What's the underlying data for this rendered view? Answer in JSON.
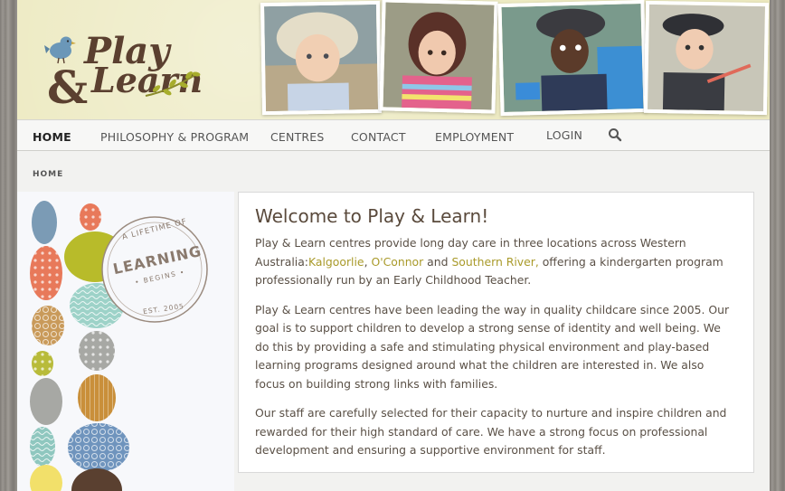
{
  "brand": {
    "logo_line1": "Play",
    "logo_amp": "&",
    "logo_line2": "Learn"
  },
  "nav": {
    "items": [
      {
        "label": "HOME",
        "active": true
      },
      {
        "label": "PHILOSOPHY & PROGRAM",
        "active": false
      },
      {
        "label": "CENTRES",
        "active": false
      },
      {
        "label": "CONTACT",
        "active": false
      },
      {
        "label": "EMPLOYMENT",
        "active": false
      },
      {
        "label": "LOGIN",
        "active": false
      }
    ],
    "search_icon": "search-icon"
  },
  "breadcrumb": "HOME",
  "badge": {
    "top": "A LIFETIME OF",
    "center": "LEARNING",
    "sub": "• BEGINS •",
    "bottom": "EST. 2005"
  },
  "main": {
    "heading": "Welcome to Play & Learn!",
    "p1_before": "Play & Learn centres provide long day care in three locations across Western Australia:",
    "link1": "Kalgoorlie",
    "sep1": ", ",
    "link2": "O'Connor",
    "sep2": " and ",
    "link3": "Southern River,",
    "p1_after": " offering a kindergarten program professionally run by an Early Childhood Teacher.",
    "p2": "Play & Learn centres have been leading the way in quality childcare since 2005. Our goal is to support children to develop a strong sense of identity and well being. We do this by providing a safe and stimulating physical environment and play-based learning programs designed around what the children are interested in. We also focus on building strong links with families.",
    "p3": "Our staff are carefully selected for their capacity to nurture and inspire children and rewarded for their high standard of care. We have a strong focus on professional development and ensuring a supportive environment for staff."
  },
  "colors": {
    "header_bg": "#ece9bf",
    "logo_brown": "#5b4030",
    "link": "#a99a2a",
    "bird": "#6b97b8",
    "leaf": "#a7ad2c"
  }
}
